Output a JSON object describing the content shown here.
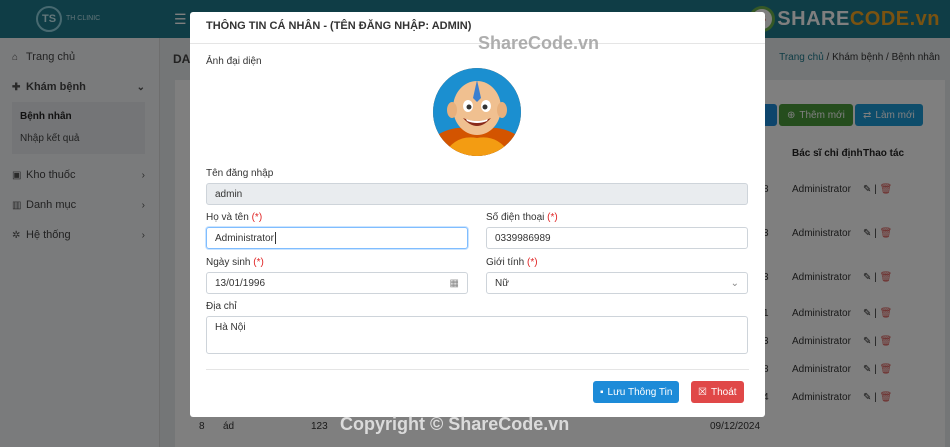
{
  "topbar": {
    "logo_mark": "TS",
    "logo_text": "TH CLINIC",
    "brand_prefix": "SHARE",
    "brand_suffix": "CODE.vn",
    "brand_mark": "S"
  },
  "sidebar": {
    "items": [
      {
        "label": "Trang chủ"
      },
      {
        "label": "Khám bệnh"
      },
      {
        "label": "Kho thuốc"
      },
      {
        "label": "Danh mục"
      },
      {
        "label": "Hệ thống"
      }
    ],
    "submenu": [
      {
        "label": "Bệnh nhân"
      },
      {
        "label": "Nhập kết quả"
      }
    ]
  },
  "main": {
    "title": "DA",
    "breadcrumb": {
      "home": "Trang chủ",
      "sep": "/",
      "section": "Khám bệnh",
      "current": "Bệnh nhân"
    },
    "buttons": {
      "add": "Thêm mới",
      "refresh": "Làm mới"
    },
    "columns": {
      "doctor": "Bác sĩ chỉ định",
      "actions": "Thao tác"
    },
    "rows": [
      {
        "doctor": "Administrator",
        "prefix": "8"
      },
      {
        "doctor": "Administrator",
        "prefix": "3"
      },
      {
        "doctor": "Administrator",
        "prefix": "3"
      },
      {
        "doctor": "Administrator",
        "prefix": "1"
      },
      {
        "doctor": "Administrator",
        "prefix": "3"
      },
      {
        "doctor": "Administrator",
        "prefix": "8"
      },
      {
        "doctor": "Administrator",
        "prefix": "4"
      }
    ],
    "last_row": {
      "stt": "8",
      "name": "ád",
      "code": "123",
      "date": "09/12/2024"
    },
    "action_sep": "|"
  },
  "modal": {
    "title": "THÔNG TIN CÁ NHÂN - (TÊN ĐĂNG NHẬP: ADMIN)",
    "avatar_label": "Ảnh đại diện",
    "username_label": "Tên đăng nhập",
    "username_value": "admin",
    "fullname_label": "Họ và tên",
    "fullname_value": "Administrator",
    "phone_label": "Số điện thoại",
    "phone_value": "0339986989",
    "dob_label": "Ngày sinh",
    "dob_value": "13/01/1996",
    "gender_label": "Giới tính",
    "gender_value": "Nữ",
    "address_label": "Địa chỉ",
    "address_value": "Hà Nội",
    "required_mark": "(*)",
    "save_label": "Lưu Thông Tin",
    "exit_label": "Thoát"
  },
  "watermarks": {
    "top": "ShareCode.vn",
    "bottom": "Copyright © ShareCode.vn"
  },
  "colors": {
    "topbar": "#1f7a8c",
    "primary": "#1d8bd8",
    "danger": "#e04848",
    "success": "#4a9a3a"
  }
}
